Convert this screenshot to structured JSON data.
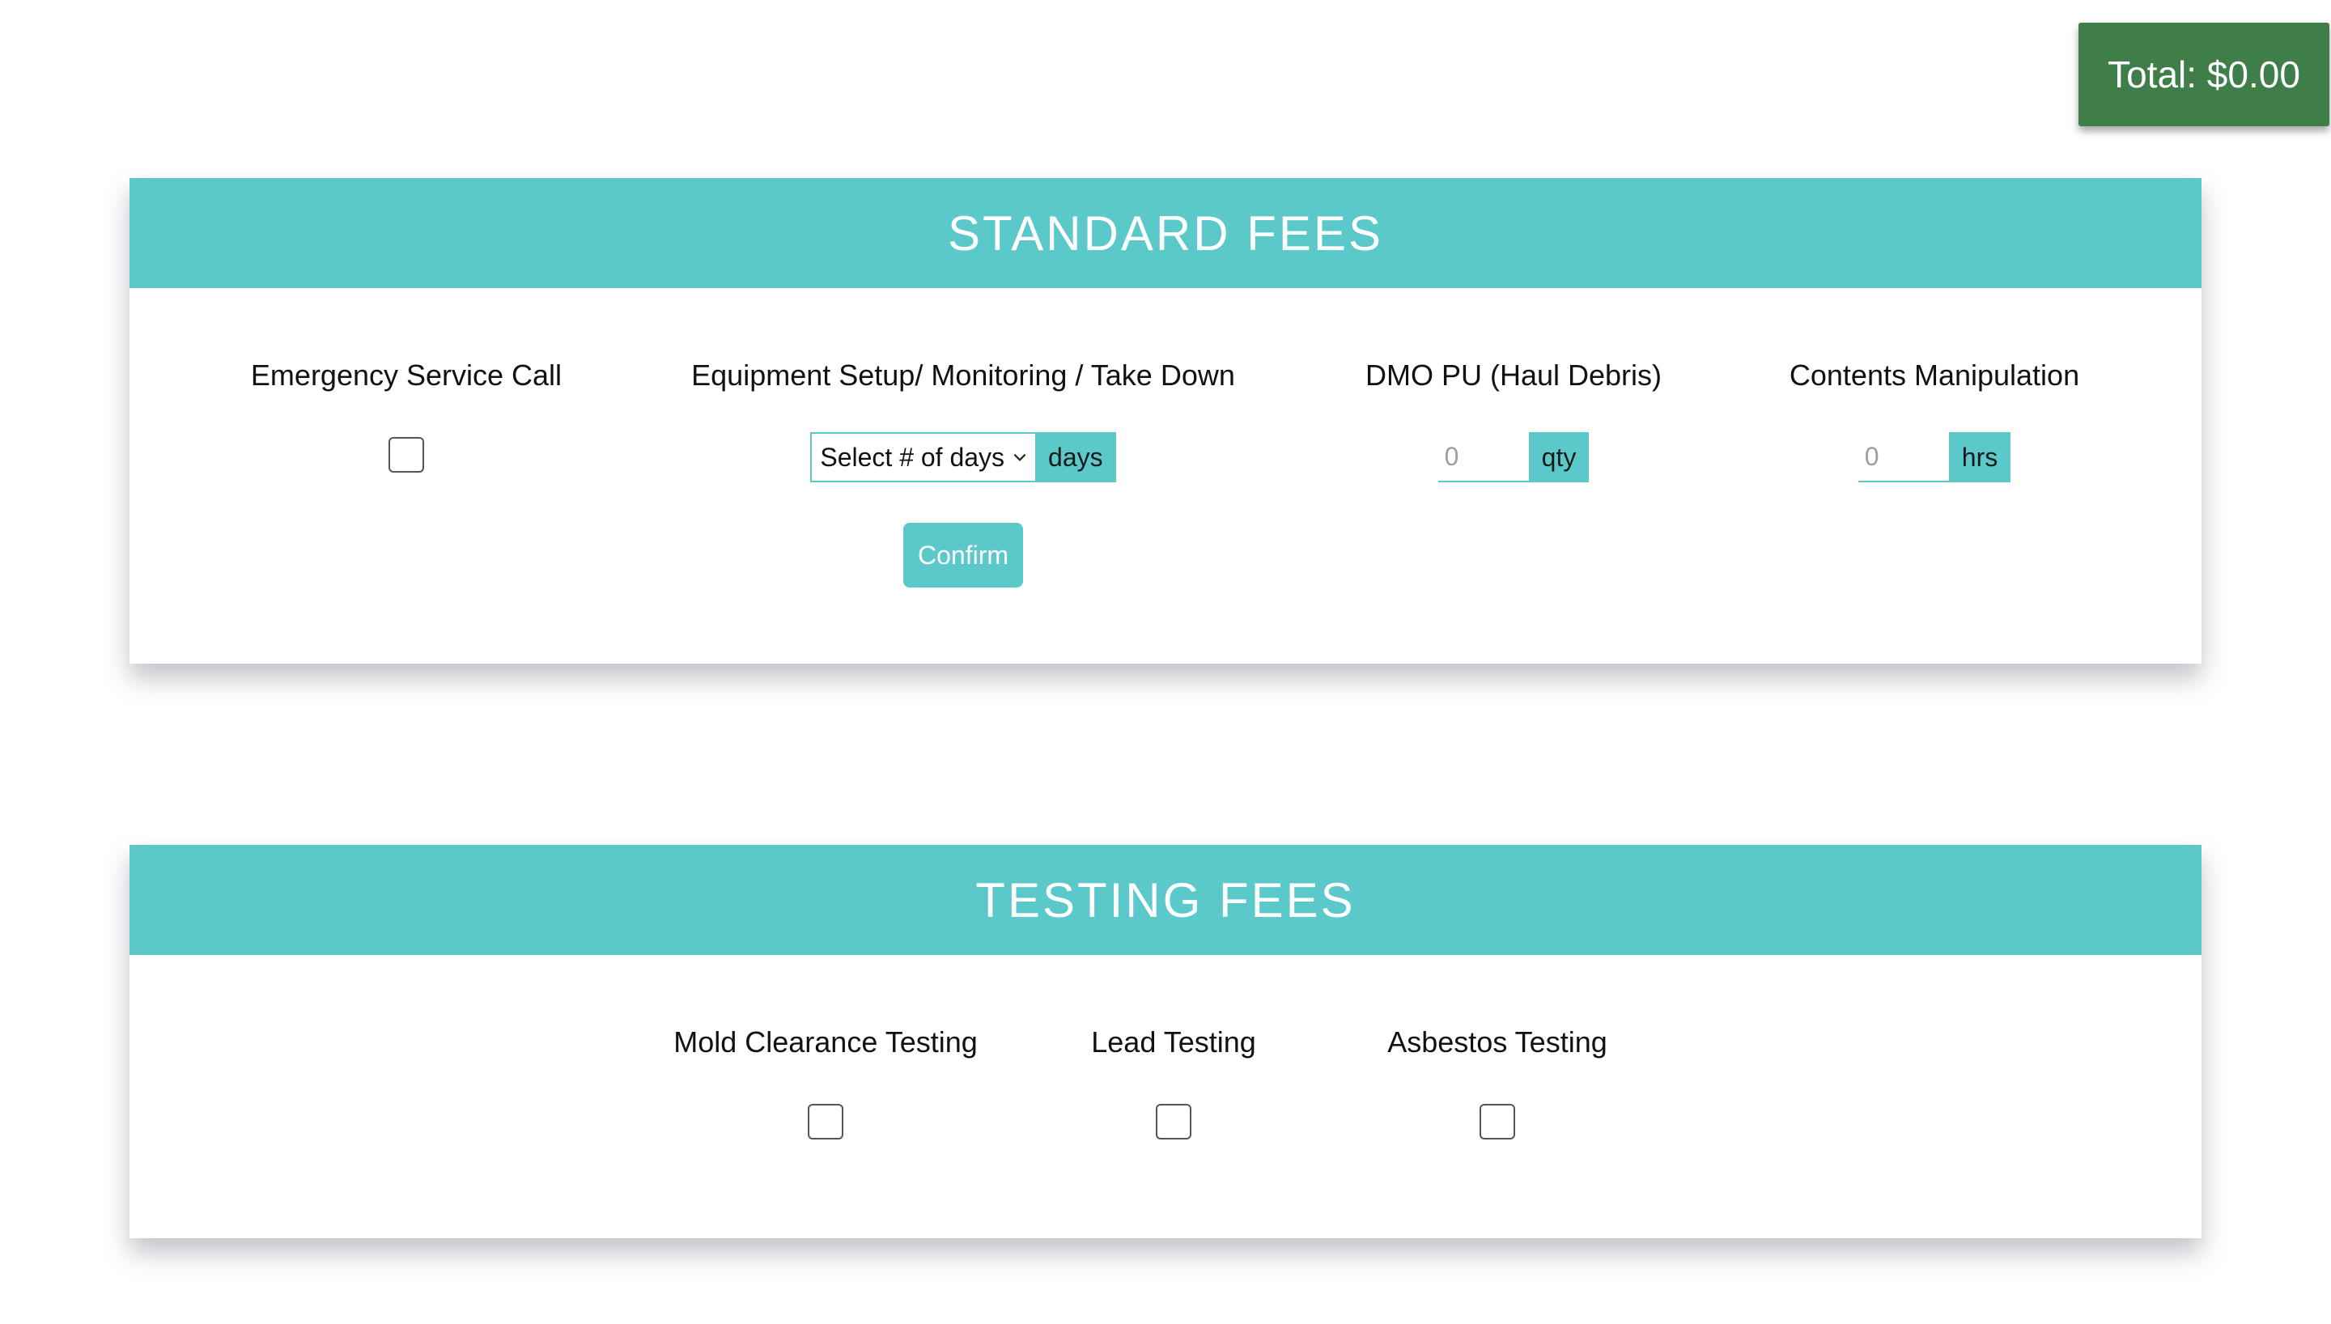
{
  "total": {
    "label": "Total: $0.00"
  },
  "standard_fees": {
    "title": "STANDARD FEES",
    "emergency": {
      "label": "Emergency Service Call"
    },
    "equipment": {
      "label": "Equipment Setup/ Monitoring / Take Down",
      "select_value": "Select # of days",
      "unit": "days",
      "confirm_label": "Confirm"
    },
    "dmo": {
      "label": "DMO PU (Haul Debris)",
      "placeholder": "0",
      "unit": "qty"
    },
    "contents": {
      "label": "Contents Manipulation",
      "placeholder": "0",
      "unit": "hrs"
    }
  },
  "testing_fees": {
    "title": "TESTING FEES",
    "items": [
      {
        "label": "Mold Clearance Testing"
      },
      {
        "label": "Lead Testing"
      },
      {
        "label": "Asbestos Testing"
      }
    ]
  },
  "colors": {
    "accent": "#5bc9ca",
    "total_bg": "#3f7d49"
  }
}
